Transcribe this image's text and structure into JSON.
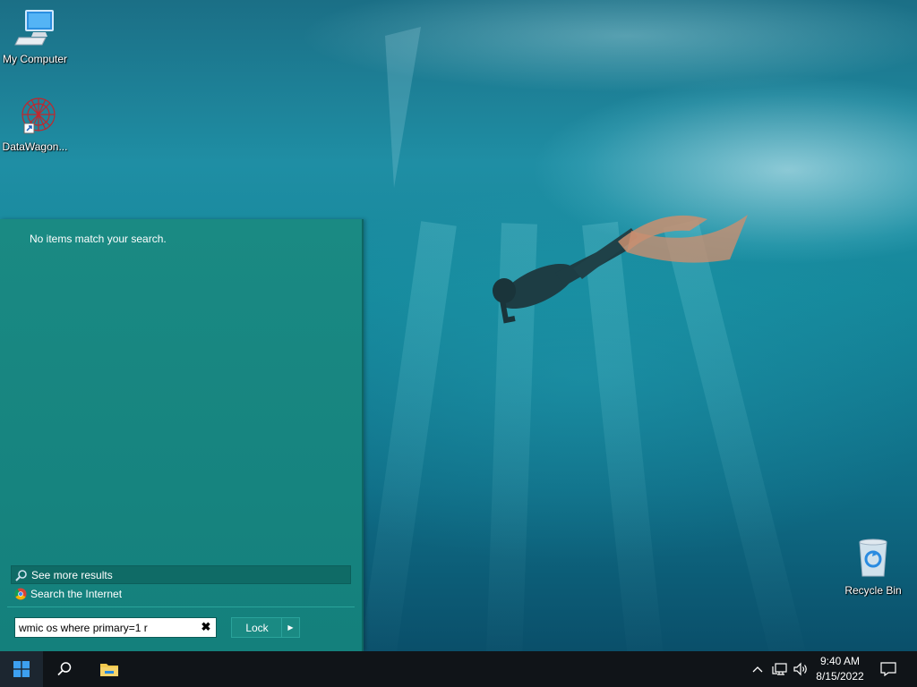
{
  "desktop": {
    "icons": [
      {
        "label": "My Computer"
      },
      {
        "label": "DataWagon..."
      },
      {
        "label": "Recycle Bin"
      }
    ]
  },
  "start_panel": {
    "no_items_text": "No items match your search.",
    "see_more_results": "See more results",
    "search_internet": "Search the Internet",
    "search_value": "wmic os where primary=1 r",
    "lock_label": "Lock"
  },
  "taskbar": {
    "time": "9:40 AM",
    "date": "8/15/2022"
  },
  "colors": {
    "panel": "#178580",
    "taskbar": "#101418",
    "highlight": "#0f6b66"
  },
  "icon_names": [
    "windows-logo-icon",
    "search-icon",
    "file-explorer-icon",
    "chevron-up-icon",
    "network-icon",
    "volume-icon",
    "notification-icon",
    "chrome-icon",
    "magnifier-icon"
  ]
}
